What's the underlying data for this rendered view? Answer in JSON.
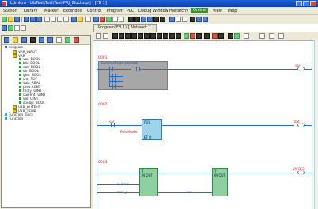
{
  "window": {
    "title": "Ldmicro - LibTest\\Test\\Test-PRJ_Blocks.prj - [FB 1]"
  },
  "menu": [
    {
      "label": "Station"
    },
    {
      "label": "Library"
    },
    {
      "label": "Marker"
    },
    {
      "label": "Extended"
    },
    {
      "label": "Control"
    },
    {
      "label": "Program"
    },
    {
      "label": "PLC"
    },
    {
      "label": "Debug"
    },
    {
      "label": "Window"
    },
    {
      "label": "Hierarchy"
    },
    {
      "label": "Online",
      "highlight": true
    },
    {
      "label": "View"
    },
    {
      "label": "Help"
    }
  ],
  "tree": {
    "root": "program",
    "items": [
      {
        "label": "VAR_INPUT",
        "color": "yellow"
      },
      {
        "label": "VAR",
        "color": "yellow"
      },
      {
        "label": "var: BOOL",
        "color": "green"
      },
      {
        "label": "blk: BOOL",
        "color": "green"
      },
      {
        "label": "dat: BOOL",
        "color": "green"
      },
      {
        "label": "en: BOOL",
        "color": "green"
      },
      {
        "label": "gen: BOOL",
        "color": "green"
      },
      {
        "label": "cnt: TOF",
        "color": "green"
      },
      {
        "label": "volt: REAL",
        "color": "green"
      },
      {
        "label": "prev: UINT",
        "color": "green"
      },
      {
        "label": "thdly: UINT",
        "color": "green"
      },
      {
        "label": "current: UINT",
        "color": "green"
      },
      {
        "label": "val: UINT",
        "color": "green"
      },
      {
        "label": "speap: BOOL",
        "color": "green"
      },
      {
        "label": "VAR_OUTPUT",
        "color": "yellow"
      },
      {
        "label": "VAR_TEMP",
        "color": "yellow"
      }
    ],
    "bottom_items": [
      {
        "label": "Function block"
      },
      {
        "label": "Function"
      }
    ]
  },
  "editor": {
    "tab": "Program(FB 1) [ Network 1 ]",
    "rungs": [
      {
        "label": "0001",
        "comment": "Comments on element",
        "coil": "var"
      },
      {
        "label": "0002",
        "contact": "var",
        "block_name": "FB1",
        "block_param": "PulseMode",
        "block_out": "ET  Q",
        "coil": "dat"
      },
      {
        "label": "0003",
        "coil": "VAR1[3]",
        "left_txt1": "in (var)",
        "left_txt2": "mon_p",
        "mid_txt": "out",
        "b1_title": "T",
        "b1_sub": "IN  OUT",
        "b2_title": "T",
        "b2_sub": "IN  OUT"
      }
    ]
  }
}
